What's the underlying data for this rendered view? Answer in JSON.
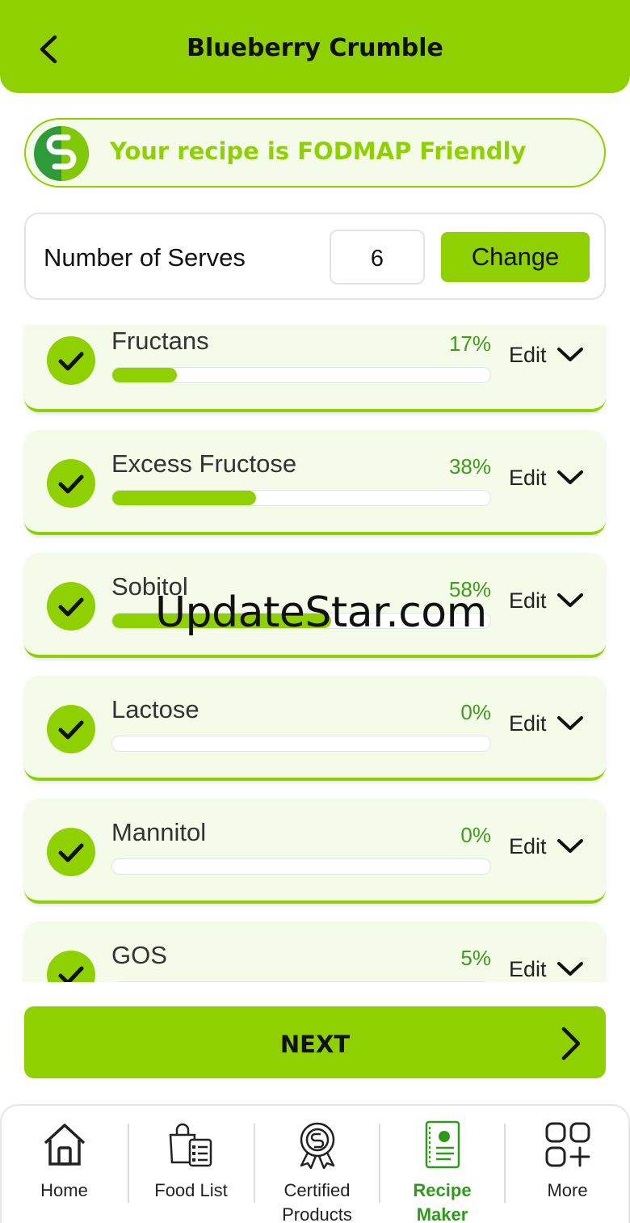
{
  "header": {
    "title": "Blueberry Crumble",
    "back_icon": "chevron-left-icon"
  },
  "banner": {
    "text": "Your recipe is FODMAP Friendly",
    "logo_icon": "fodmap-logo-icon"
  },
  "serves": {
    "label": "Number of Serves",
    "value": "6",
    "change_label": "Change"
  },
  "nutrients": [
    {
      "name": "Fructans",
      "percent_label": "17%",
      "percent": 17,
      "edit_label": "Edit"
    },
    {
      "name": "Excess Fructose",
      "percent_label": "38%",
      "percent": 38,
      "edit_label": "Edit"
    },
    {
      "name": "Sobitol",
      "percent_label": "58%",
      "percent": 58,
      "edit_label": "Edit"
    },
    {
      "name": "Lactose",
      "percent_label": "0%",
      "percent": 0,
      "edit_label": "Edit"
    },
    {
      "name": "Mannitol",
      "percent_label": "0%",
      "percent": 0,
      "edit_label": "Edit"
    },
    {
      "name": "GOS",
      "percent_label": "5%",
      "percent": 5,
      "edit_label": "Edit"
    }
  ],
  "next_button": {
    "label": "NEXT"
  },
  "bottom_nav": [
    {
      "label": "Home",
      "icon": "home-icon",
      "active": false
    },
    {
      "label": "Food List",
      "icon": "food-list-icon",
      "active": false
    },
    {
      "label": "Certified\nProducts",
      "icon": "certified-badge-icon",
      "active": false
    },
    {
      "label": "Recipe\nMaker",
      "icon": "recipe-book-icon",
      "active": true
    },
    {
      "label": "More",
      "icon": "grid-plus-icon",
      "active": false
    }
  ],
  "watermark": "UpdateStar.com",
  "colors": {
    "accent": "#8fd100",
    "accent_dark": "#2f9a1a",
    "card_bg": "#f4fbe8"
  }
}
